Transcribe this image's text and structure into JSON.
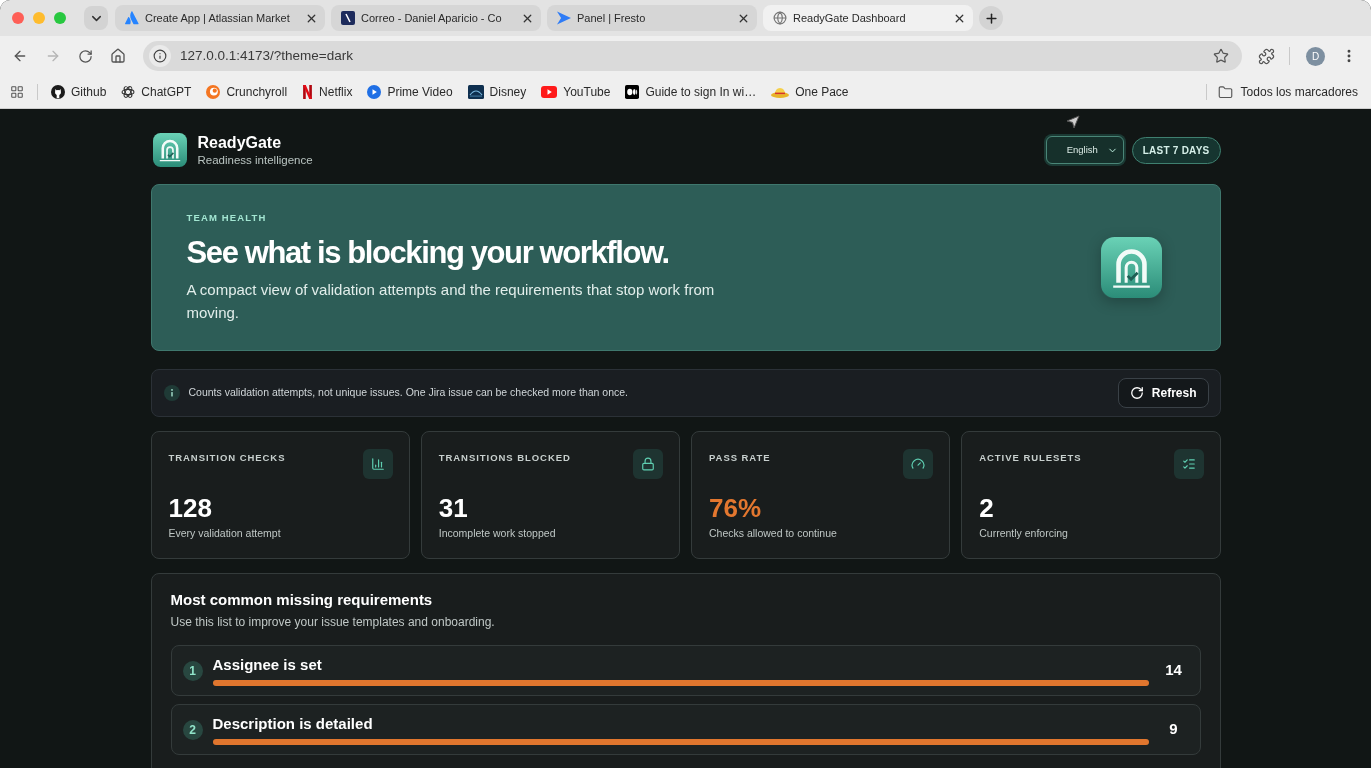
{
  "browser": {
    "tabs": [
      {
        "title": "Create App | Atlassian Market",
        "selected": false
      },
      {
        "title": "Correo - Daniel Aparicio - Co",
        "selected": false
      },
      {
        "title": "Panel | Fresto",
        "selected": false
      },
      {
        "title": "ReadyGate Dashboard",
        "selected": true
      }
    ],
    "url": "127.0.0.1:4173/?theme=dark",
    "profile_initial": "D",
    "bookmarks": [
      {
        "label": "Github"
      },
      {
        "label": "ChatGPT"
      },
      {
        "label": "Crunchyroll"
      },
      {
        "label": "Netflix"
      },
      {
        "label": "Prime Video"
      },
      {
        "label": "Disney"
      },
      {
        "label": "YouTube"
      },
      {
        "label": "Guide to sign In wi…"
      },
      {
        "label": "One Pace"
      }
    ],
    "all_bookmarks": "Todos los marcadores"
  },
  "header": {
    "app_name": "ReadyGate",
    "tagline": "Readiness intelligence",
    "language": "English",
    "range_button": "LAST 7 DAYS"
  },
  "hero": {
    "eyebrow": "TEAM HEALTH",
    "title": "See what is blocking your workflow.",
    "description": "A compact view of validation attempts and the requirements that stop work from moving."
  },
  "notice": {
    "text": "Counts validation attempts, not unique issues. One Jira issue can be checked more than once.",
    "button": "Refresh"
  },
  "stats": [
    {
      "label": "TRANSITION CHECKS",
      "value": "128",
      "caption": "Every validation attempt",
      "highlighted": false
    },
    {
      "label": "TRANSITIONS BLOCKED",
      "value": "31",
      "caption": "Incomplete work stopped",
      "highlighted": false
    },
    {
      "label": "PASS RATE",
      "value": "76%",
      "caption": "Checks allowed to continue",
      "highlighted": true
    },
    {
      "label": "ACTIVE RULESETS",
      "value": "2",
      "caption": "Currently enforcing",
      "highlighted": false
    }
  ],
  "requirements": {
    "title": "Most common missing requirements",
    "subtitle": "Use this list to improve your issue templates and onboarding.",
    "items": [
      {
        "rank": "1",
        "label": "Assignee is set",
        "count": "14",
        "level": 1.0
      },
      {
        "rank": "2",
        "label": "Description is detailed",
        "count": "9",
        "level": 1.0
      }
    ]
  }
}
